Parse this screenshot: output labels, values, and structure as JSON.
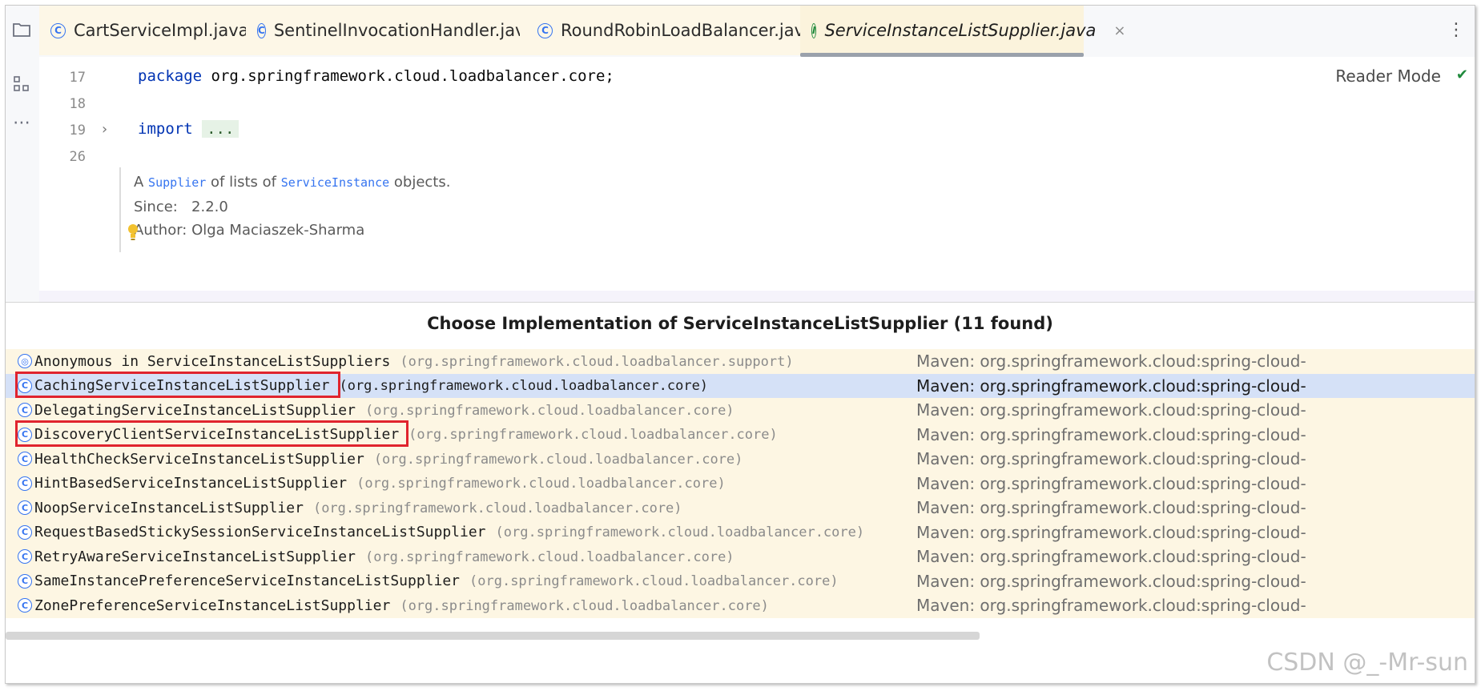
{
  "tabs": [
    {
      "label": "CartServiceImpl.java",
      "icon": "class-icon"
    },
    {
      "label": "SentinelInvocationHandler.java",
      "icon": "class-icon"
    },
    {
      "label": "RoundRobinLoadBalancer.java",
      "icon": "class-icon"
    },
    {
      "label": "ServiceInstanceListSupplier.java",
      "icon": "interface-icon",
      "active": true,
      "close": "×"
    }
  ],
  "editor": {
    "reader_mode": "Reader Mode",
    "lines": [
      {
        "num": "17",
        "keyword": "package",
        "text": " org.springframework.cloud.loadbalancer.core;"
      },
      {
        "num": "18",
        "keyword": "",
        "text": ""
      },
      {
        "num": "19",
        "keyword": "import",
        "text": " ..."
      },
      {
        "num": "26",
        "keyword": "",
        "text": ""
      }
    ],
    "doc": {
      "prefix": "A ",
      "link1": "Supplier",
      "middle": " of lists of ",
      "link2": "ServiceInstance",
      "suffix": " objects.",
      "since_label": "Since:",
      "since_value": "2.2.0",
      "author": "Author: Olga Maciaszek-Sharma"
    }
  },
  "popup": {
    "title": "Choose Implementation of ServiceInstanceListSupplier (11 found)",
    "maven": "Maven: org.springframework.cloud:spring-cloud-",
    "items": [
      {
        "name": "Anonymous in ServiceInstanceListSuppliers",
        "pkg": "(org.springframework.cloud.loadbalancer.support)",
        "icon": "anonymous-class-icon"
      },
      {
        "name": "CachingServiceInstanceListSupplier",
        "pkg": "(org.springframework.cloud.loadbalancer.core)",
        "selected": true,
        "highlighted": true
      },
      {
        "name": "DelegatingServiceInstanceListSupplier",
        "pkg": "(org.springframework.cloud.loadbalancer.core)"
      },
      {
        "name": "DiscoveryClientServiceInstanceListSupplier",
        "pkg": "(org.springframework.cloud.loadbalancer.core)",
        "highlighted": true
      },
      {
        "name": "HealthCheckServiceInstanceListSupplier",
        "pkg": "(org.springframework.cloud.loadbalancer.core)"
      },
      {
        "name": "HintBasedServiceInstanceListSupplier",
        "pkg": "(org.springframework.cloud.loadbalancer.core)"
      },
      {
        "name": "NoopServiceInstanceListSupplier",
        "pkg": "(org.springframework.cloud.loadbalancer.core)"
      },
      {
        "name": "RequestBasedStickySessionServiceInstanceListSupplier",
        "pkg": "(org.springframework.cloud.loadbalancer.core)"
      },
      {
        "name": "RetryAwareServiceInstanceListSupplier",
        "pkg": "(org.springframework.cloud.loadbalancer.core)"
      },
      {
        "name": "SameInstancePreferenceServiceInstanceListSupplier",
        "pkg": "(org.springframework.cloud.loadbalancer.core)"
      },
      {
        "name": "ZonePreferenceServiceInstanceListSupplier",
        "pkg": "(org.springframework.cloud.loadbalancer.core)"
      }
    ]
  },
  "watermark": "CSDN @_-Mr-sun",
  "colors": {
    "accent": "#3574f0",
    "selection": "#d5e1f7",
    "row_bg": "#fdf6e3",
    "highlight_box": "#e0242e",
    "interface_icon": "#208a3c"
  }
}
